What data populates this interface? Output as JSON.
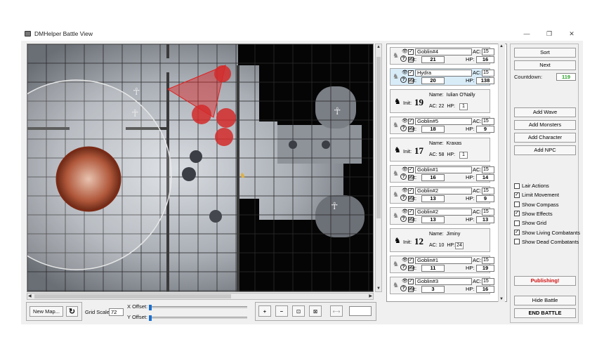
{
  "window": {
    "title": "DMHelper Battle View",
    "min": "—",
    "max": "❐",
    "close": "✕"
  },
  "bottom": {
    "new_map": "New Map...",
    "grid_scale_label": "Grid Scale:",
    "grid_scale_value": "72",
    "x_offset_label": "X Offset:",
    "y_offset_label": "Y Offset:",
    "zoom_in": "+",
    "zoom_out": "−"
  },
  "combatants": [
    {
      "type": "monster",
      "name": "Goblin#4",
      "ac": "15",
      "init": "21",
      "hp": "16",
      "selected": false
    },
    {
      "type": "monster",
      "name": "Hydra",
      "ac": "15",
      "init": "20",
      "hp": "138",
      "selected": true
    },
    {
      "type": "pc",
      "name_label": "Name:",
      "name": "Iulian O'Nally",
      "init_label": "Init:",
      "init": "19",
      "ac_label": "AC:",
      "ac": "22",
      "hp_label": "HP:",
      "hp": "1"
    },
    {
      "type": "monster",
      "name": "Goblin#5",
      "ac": "15",
      "init": "18",
      "hp": "9",
      "selected": false
    },
    {
      "type": "pc",
      "name_label": "Name:",
      "name": "Kraxas",
      "init_label": "Init:",
      "init": "17",
      "ac_label": "AC:",
      "ac": "58",
      "hp_label": "HP:",
      "hp": "1"
    },
    {
      "type": "monster",
      "name": "Goblin#1",
      "ac": "15",
      "init": "16",
      "hp": "14",
      "selected": false
    },
    {
      "type": "monster",
      "name": "Goblin#2",
      "ac": "15",
      "init": "13",
      "hp": "9",
      "selected": false
    },
    {
      "type": "monster",
      "name": "Goblin#2",
      "ac": "15",
      "init": "13",
      "hp": "13",
      "selected": false
    },
    {
      "type": "pc",
      "name_label": "Name:",
      "name": "Jiminy",
      "init_label": "Init:",
      "init": "12",
      "ac_label": "AC:",
      "ac": "10",
      "hp_label": "HP:",
      "hp": "24"
    },
    {
      "type": "monster",
      "name": "Goblin#1",
      "ac": "15",
      "init": "11",
      "hp": "19",
      "selected": false
    },
    {
      "type": "monster",
      "name": "Goblin#3",
      "ac": "15",
      "init": "3",
      "hp": "16",
      "selected": false
    }
  ],
  "labels": {
    "init": "Init:",
    "ac": "AC:",
    "hp": "HP:"
  },
  "controls": {
    "sort": "Sort",
    "next": "Next",
    "countdown_label": "Countdown:",
    "countdown_value": "119",
    "add_wave": "Add Wave",
    "add_monsters": "Add Monsters",
    "add_character": "Add Character",
    "add_npc": "Add NPC",
    "options": [
      {
        "label": "Lair Actions",
        "checked": false
      },
      {
        "label": "Limit Movement",
        "checked": true
      },
      {
        "label": "Show Compass",
        "checked": false
      },
      {
        "label": "Show Effects",
        "checked": true
      },
      {
        "label": "Show Grid",
        "checked": false
      },
      {
        "label": "Show Living Combatants",
        "checked": true
      },
      {
        "label": "Show Dead Combatants",
        "checked": false
      }
    ],
    "publishing": "Publishing!",
    "hide_battle": "Hide Battle",
    "end_battle": "END BATTLE"
  }
}
